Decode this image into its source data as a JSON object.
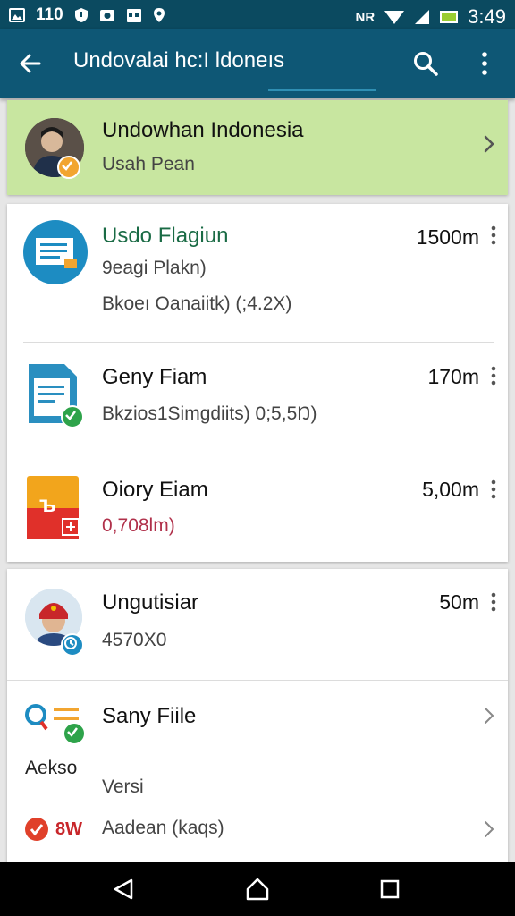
{
  "status_bar": {
    "left_indicator": "110",
    "time": "3:49",
    "right_indicator": "NR",
    "icons": [
      "photo-icon",
      "shield-icon",
      "camera-icon",
      "calendar-icon",
      "location-icon",
      "signal-icon",
      "battery-icon"
    ]
  },
  "app_bar": {
    "title": "Undovalai hc:I ldoneıs",
    "icons": [
      "back-arrow-icon",
      "search-icon",
      "more-vert-icon"
    ]
  },
  "header_card": {
    "title": "Undowhan Indonesia",
    "subtitle": "Usah Pean",
    "icon": "chevron-right-icon",
    "background": "#c8e6a0"
  },
  "list_group_1": [
    {
      "title": "Usdo Flagiun",
      "subtitle": "9eagi Plakn)",
      "detail": "Bkoeı Oanaiitk)  (;4.2X)",
      "duration": "1500m",
      "title_color": "#1a6b45"
    },
    {
      "title": "Geny Fiam",
      "subtitle": "Bkzios1Simgdiits)  0;5,5Ŋ)",
      "duration": "170m"
    },
    {
      "title": "Oiory Eiam",
      "subtitle": "0,708lm)",
      "duration": "5,00m",
      "subtitle_color": "#b0304a"
    }
  ],
  "list_group_2": [
    {
      "title": "Ungutisiar",
      "subtitle": "4570X0",
      "duration": "50m"
    },
    {
      "title": "Sany Fiile",
      "side_label": "Aekso",
      "subtitle": "Versi"
    },
    {
      "logo_text": "8W",
      "subtitle": "Aadean (kaqs)"
    }
  ],
  "nav_bar": {
    "icons": [
      "back-triangle-icon",
      "home-icon",
      "recents-icon"
    ]
  }
}
